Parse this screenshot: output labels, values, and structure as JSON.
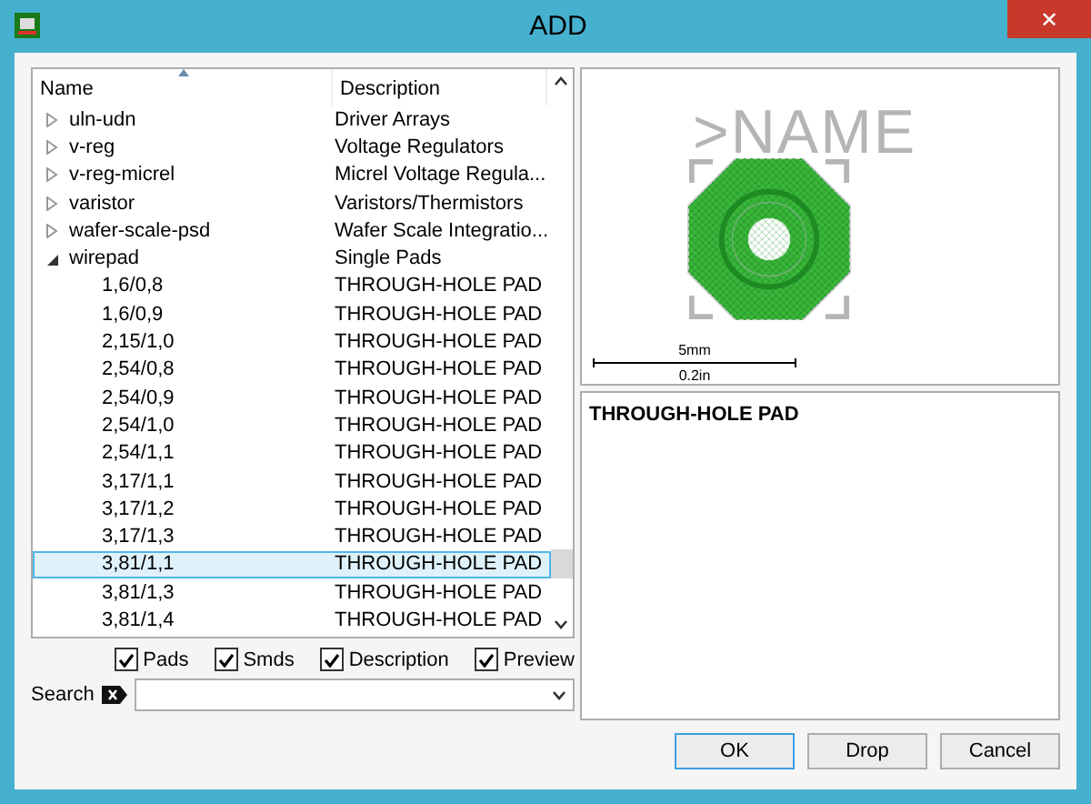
{
  "window": {
    "title": "ADD",
    "close": "✕"
  },
  "tree": {
    "columns": [
      "Name",
      "Description"
    ],
    "items": [
      {
        "name": "uln-udn",
        "description": "Driver Arrays",
        "expanded": false,
        "selected": false
      },
      {
        "name": "v-reg",
        "description": "Voltage Regulators",
        "expanded": false,
        "selected": false
      },
      {
        "name": "v-reg-micrel",
        "description": "Micrel Voltage Regula...",
        "expanded": false,
        "selected": false
      },
      {
        "name": "varistor",
        "description": "Varistors/Thermistors",
        "expanded": false,
        "selected": false
      },
      {
        "name": "wafer-scale-psd",
        "description": "Wafer Scale Integratio...",
        "expanded": false,
        "selected": false
      },
      {
        "name": "wirepad",
        "description": "Single Pads",
        "expanded": true,
        "selected": false,
        "children": [
          {
            "name": "1,6/0,8",
            "description": "THROUGH-HOLE PAD",
            "selected": false
          },
          {
            "name": "1,6/0,9",
            "description": "THROUGH-HOLE PAD",
            "selected": false
          },
          {
            "name": "2,15/1,0",
            "description": "THROUGH-HOLE PAD",
            "selected": false
          },
          {
            "name": "2,54/0,8",
            "description": "THROUGH-HOLE PAD",
            "selected": false
          },
          {
            "name": "2,54/0,9",
            "description": "THROUGH-HOLE PAD",
            "selected": false
          },
          {
            "name": "2,54/1,0",
            "description": "THROUGH-HOLE PAD",
            "selected": false
          },
          {
            "name": "2,54/1,1",
            "description": "THROUGH-HOLE PAD",
            "selected": false
          },
          {
            "name": "3,17/1,1",
            "description": "THROUGH-HOLE PAD",
            "selected": false
          },
          {
            "name": "3,17/1,2",
            "description": "THROUGH-HOLE PAD",
            "selected": false
          },
          {
            "name": "3,17/1,3",
            "description": "THROUGH-HOLE PAD",
            "selected": false
          },
          {
            "name": "3,81/1,1",
            "description": "THROUGH-HOLE PAD",
            "selected": true
          },
          {
            "name": "3,81/1,3",
            "description": "THROUGH-HOLE PAD",
            "selected": false
          },
          {
            "name": "3,81/1,4",
            "description": "THROUGH-HOLE PAD",
            "selected": false
          }
        ]
      }
    ]
  },
  "filters": [
    {
      "label": "Pads",
      "checked": true
    },
    {
      "label": "Smds",
      "checked": true
    },
    {
      "label": "Description",
      "checked": true
    },
    {
      "label": "Preview",
      "checked": true
    }
  ],
  "search": {
    "label": "Search"
  },
  "preview": {
    "name_label": ">NAME",
    "scale_top": "5mm",
    "scale_bottom": "0.2in"
  },
  "description": "THROUGH-HOLE PAD",
  "buttons": [
    {
      "label": "OK",
      "default": true
    },
    {
      "label": "Drop",
      "default": false
    },
    {
      "label": "Cancel",
      "default": false
    }
  ]
}
